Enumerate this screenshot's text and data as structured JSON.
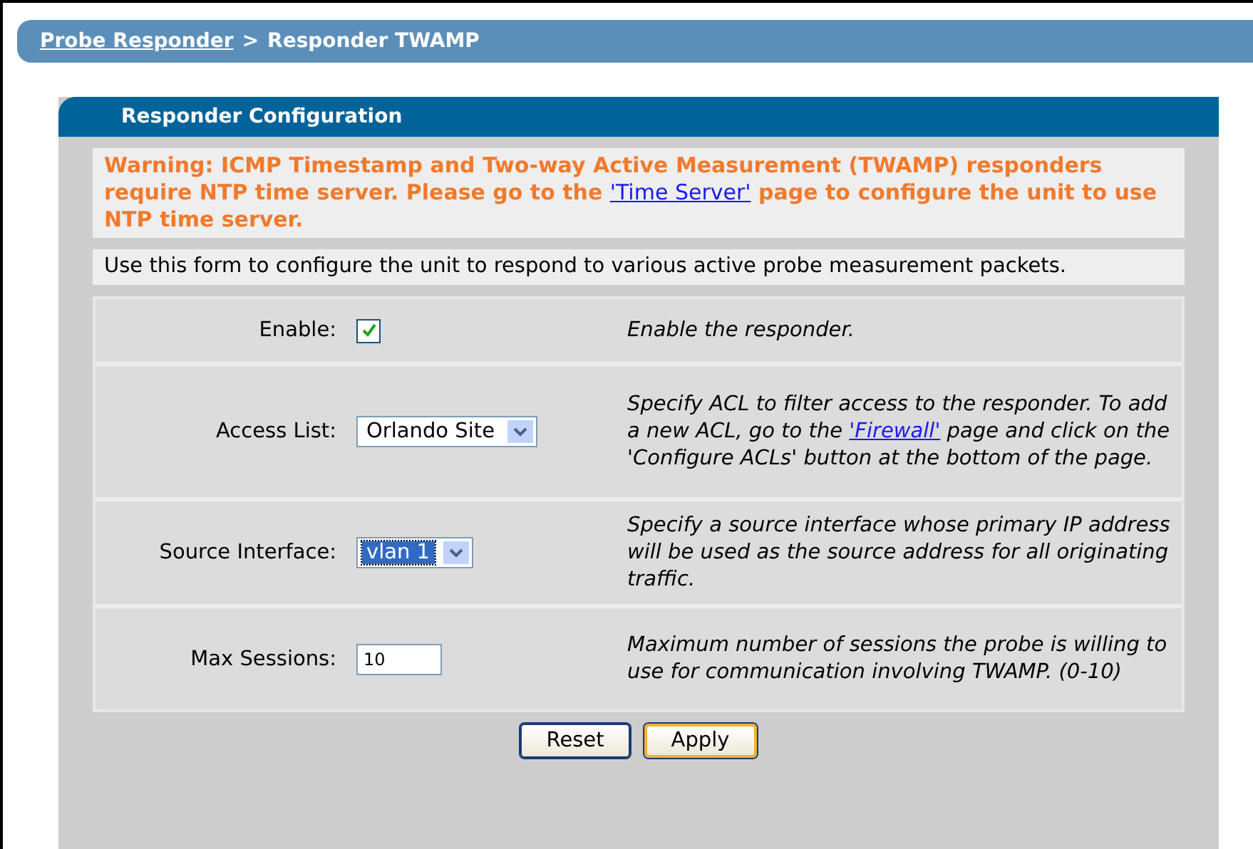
{
  "breadcrumb": {
    "link": "Probe Responder",
    "separator": ">",
    "current": "Responder TWAMP"
  },
  "panel": {
    "title": "Responder Configuration",
    "warning": {
      "before": "Warning: ICMP Timestamp and Two-way Active Measurement (TWAMP) responders require NTP time server. Please go to the ",
      "link": "'Time Server'",
      "after": " page to configure the unit to use NTP time server."
    },
    "intro": "Use this form to configure the unit to respond to various active probe measurement packets.",
    "rows": [
      {
        "kind": "checkbox",
        "label": "Enable:",
        "checked": true,
        "description": {
          "before": "Enable the responder."
        }
      },
      {
        "kind": "select",
        "label": "Access List:",
        "value": "Orlando Site",
        "focused": false,
        "description": {
          "before": "Specify ACL to filter access to the responder. To add a new ACL, go to the ",
          "link": "'Firewall'",
          "after": " page and click on the 'Configure ACLs' button at the bottom of the page."
        }
      },
      {
        "kind": "select",
        "label": "Source Interface:",
        "value": "vlan 1",
        "focused": true,
        "description": {
          "before": "Specify a source interface whose primary IP address will be used as the source address for all originating traffic."
        }
      },
      {
        "kind": "text",
        "label": "Max Sessions:",
        "value": "10",
        "description": {
          "before": "Maximum number of sessions the probe is willing to use for communication involving TWAMP. (0-10)"
        }
      }
    ],
    "buttons": [
      {
        "label": "Reset",
        "default": false
      },
      {
        "label": "Apply",
        "default": true
      }
    ]
  }
}
